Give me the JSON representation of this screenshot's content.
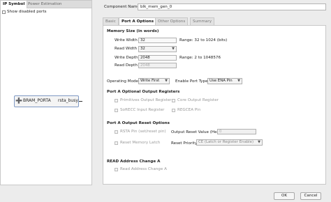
{
  "left_panel": {
    "tabs": [
      "IP Symbol",
      "Power Estimation"
    ],
    "show_disabled_ports": "Show disabled ports",
    "symbol": {
      "left_label": "BRAM_PORTA",
      "right_label": "rsta_busy"
    }
  },
  "header": {
    "component_name_label": "Component Name",
    "component_name_value": "blk_mem_gen_0"
  },
  "tabs": [
    "Basic",
    "Port A Options",
    "Other Options",
    "Summary"
  ],
  "memory_size": {
    "title": "Memory Size (in words)",
    "write_width_label": "Write Width",
    "write_width_value": "32",
    "write_width_range": "Range: 32 to 1024 (bits)",
    "read_width_label": "Read Width",
    "read_width_value": "32",
    "write_depth_label": "Write Depth",
    "write_depth_value": "2048",
    "write_depth_range": "Range: 2 to 1048576",
    "read_depth_label": "Read Depth",
    "read_depth_value": "2048"
  },
  "operating": {
    "mode_label": "Operating Mode",
    "mode_value": "Write First",
    "enable_port_label": "Enable Port Type",
    "enable_port_value": "Use ENA Pin"
  },
  "optional_output": {
    "title": "Port A Optional Output Registers",
    "primitives_reg": "Primitives Output Register",
    "core_reg": "Core Output Register",
    "softecc_reg": "SoftECC Input Register",
    "regcea_pin": "REGCEA Pin"
  },
  "reset_options": {
    "title": "Port A Output Reset Options",
    "rsta_pin": "RSTA Pin (set/reset pin)",
    "output_reset_label": "Output Reset Value (Hex)",
    "output_reset_value": "0",
    "reset_latch": "Reset Memory Latch",
    "reset_priority_label": "Reset Priority",
    "reset_priority_value": "CE (Latch or Register Enable)"
  },
  "read_change": {
    "title": "READ Address Change A",
    "read_address_change": "Read Address Change A"
  },
  "buttons": {
    "ok": "OK",
    "cancel": "Cancel"
  }
}
